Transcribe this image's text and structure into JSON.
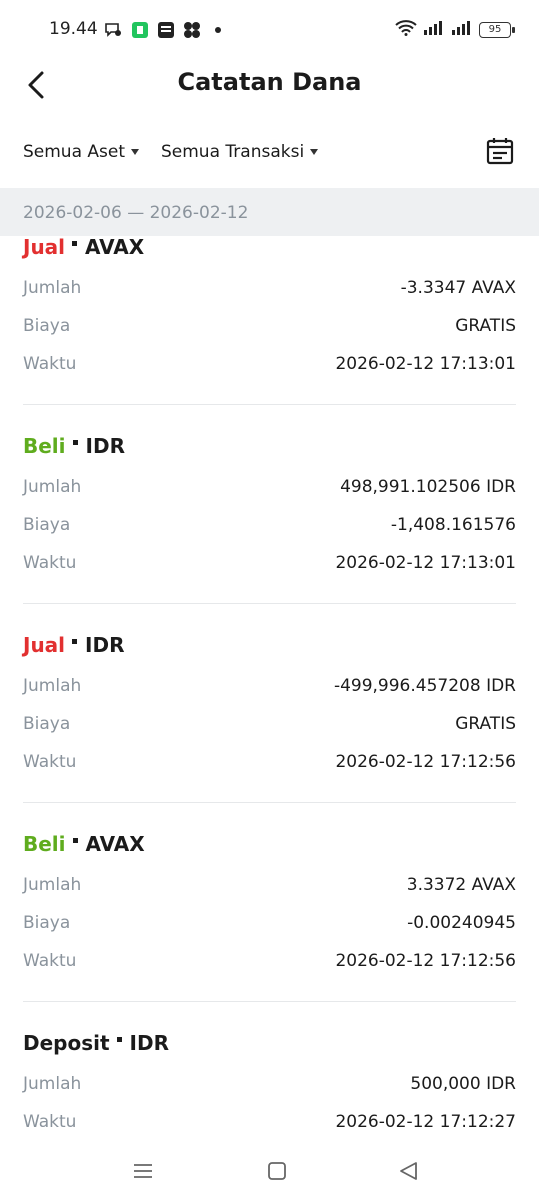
{
  "status_bar": {
    "time": "19.44",
    "battery": "95"
  },
  "header": {
    "title": "Catatan Dana"
  },
  "filters": {
    "asset": "Semua Aset",
    "transaction": "Semua Transaksi"
  },
  "date_range": "2026-02-06 — 2026-02-12",
  "colors": {
    "sell": "#e23030",
    "buy": "#5fac1e",
    "muted": "#8a939c"
  },
  "records": [
    {
      "type": "Jual",
      "asset": "AVAX",
      "rows": [
        {
          "label": "Jumlah",
          "value": "-3.3347 AVAX"
        },
        {
          "label": "Biaya",
          "value": "GRATIS"
        },
        {
          "label": "Waktu",
          "value": "2026-02-12 17:13:01"
        }
      ]
    },
    {
      "type": "Beli",
      "asset": "IDR",
      "rows": [
        {
          "label": "Jumlah",
          "value": "498,991.102506 IDR"
        },
        {
          "label": "Biaya",
          "value": "-1,408.161576"
        },
        {
          "label": "Waktu",
          "value": "2026-02-12 17:13:01"
        }
      ]
    },
    {
      "type": "Jual",
      "asset": "IDR",
      "rows": [
        {
          "label": "Jumlah",
          "value": "-499,996.457208 IDR"
        },
        {
          "label": "Biaya",
          "value": "GRATIS"
        },
        {
          "label": "Waktu",
          "value": "2026-02-12 17:12:56"
        }
      ]
    },
    {
      "type": "Beli",
      "asset": "AVAX",
      "rows": [
        {
          "label": "Jumlah",
          "value": "3.3372 AVAX"
        },
        {
          "label": "Biaya",
          "value": "-0.00240945"
        },
        {
          "label": "Waktu",
          "value": "2026-02-12 17:12:56"
        }
      ]
    },
    {
      "type": "Deposit",
      "asset": "IDR",
      "rows": [
        {
          "label": "Jumlah",
          "value": "500,000 IDR"
        },
        {
          "label": "Waktu",
          "value": "2026-02-12 17:12:27"
        }
      ]
    }
  ],
  "icons": {
    "back": "back-arrow-icon",
    "calendar": "calendar-icon",
    "nav_menu": "menu-icon",
    "nav_home": "home-icon",
    "nav_back": "nav-back-icon"
  }
}
